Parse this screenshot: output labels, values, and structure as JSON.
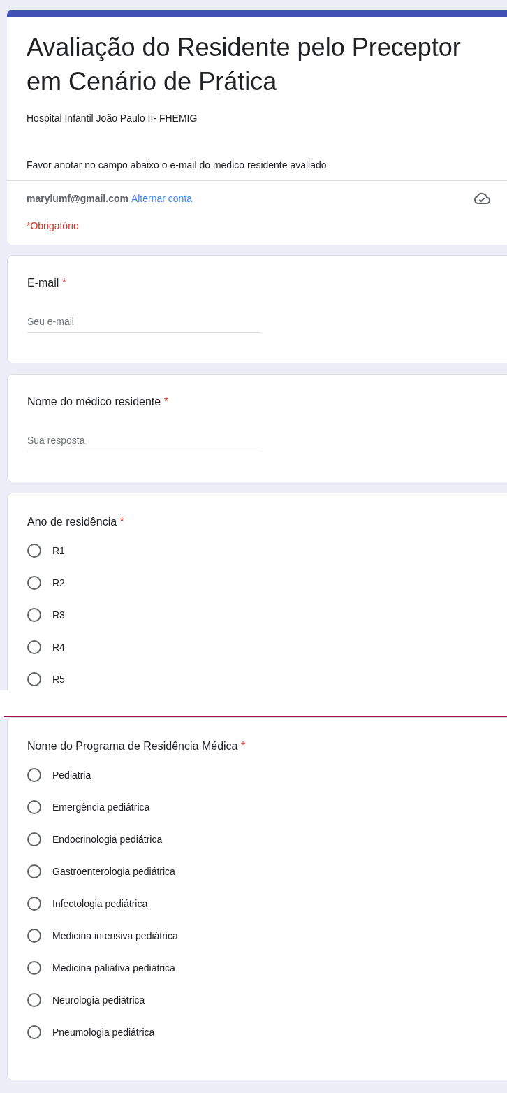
{
  "form": {
    "title": "Avaliação do Residente pelo Preceptor em Cenário de Prática",
    "subtitle": "Hospital Infantil João Paulo II- FHEMIG",
    "instructions": "Favor anotar no campo abaixo o e-mail do medico residente avaliado",
    "account": "marylumf@gmail.com",
    "switch_account": "Alternar conta",
    "required_note": "*Obrigatório"
  },
  "questions": [
    {
      "kind": "text",
      "label": "E-mail",
      "required_mark": "*",
      "placeholder": "Seu e-mail"
    },
    {
      "kind": "text",
      "label": "Nome do médico residente",
      "required_mark": "*",
      "placeholder": "Sua resposta"
    },
    {
      "kind": "radio",
      "label": "Ano de residência",
      "required_mark": "*",
      "options": [
        {
          "label": "R1",
          "selected": false
        },
        {
          "label": "R2",
          "selected": false
        },
        {
          "label": "R3",
          "selected": false
        },
        {
          "label": "R4",
          "selected": false
        },
        {
          "label": "R5",
          "selected": false
        }
      ]
    },
    {
      "kind": "radio",
      "label": "Nome do Programa de Residência Médica",
      "required_mark": "*",
      "options": [
        {
          "label": "Pediatria",
          "selected": false
        },
        {
          "label": "Emergência pediátrica",
          "selected": false
        },
        {
          "label": "Endocrinologia pediátrica",
          "selected": false
        },
        {
          "label": "Gastroenterologia pediátrica",
          "selected": false
        },
        {
          "label": "Infectologia pediátrica",
          "selected": false
        },
        {
          "label": "Medicina intensiva pediátrica",
          "selected": false
        },
        {
          "label": "Medicina paliativa pediátrica",
          "selected": false
        },
        {
          "label": "Neurologia pediátrica",
          "selected": false
        },
        {
          "label": "Pneumologia pediátrica",
          "selected": false
        }
      ]
    }
  ]
}
